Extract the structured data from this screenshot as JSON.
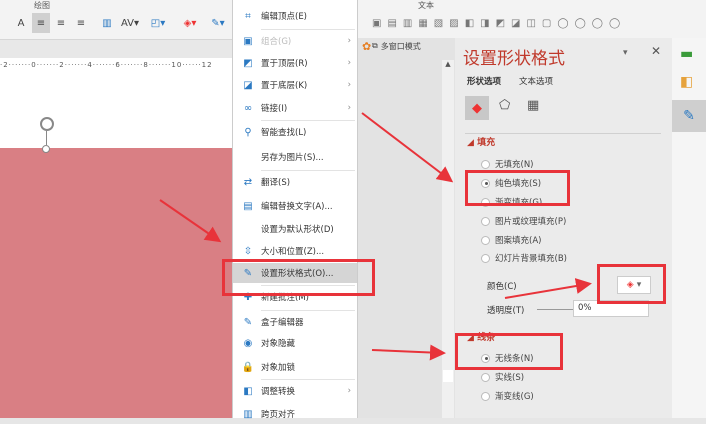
{
  "ribbon": {
    "group_drawing": "绘图",
    "group_text": "文本"
  },
  "ruler": {
    "text": "·2·······0·······2·······4·······6·······8·······10······12"
  },
  "context_menu": {
    "items": [
      {
        "label": "编辑顶点(E)",
        "icon": "edit-points-icon"
      },
      {
        "label": "组合(G)",
        "icon": "group-icon",
        "disabled": true,
        "submenu": true
      },
      {
        "label": "置于顶层(R)",
        "icon": "bring-to-front-icon",
        "submenu": true
      },
      {
        "label": "置于底层(K)",
        "icon": "send-to-back-icon",
        "submenu": true
      },
      {
        "label": "链接(I)",
        "icon": "link-icon",
        "submenu": true
      },
      {
        "label": "智能查找(L)",
        "icon": "search-icon"
      },
      {
        "label": "另存为图片(S)...",
        "icon": ""
      },
      {
        "label": "翻译(S)",
        "icon": "translate-icon"
      },
      {
        "label": "编辑替换文字(A)...",
        "icon": "alt-text-icon"
      },
      {
        "label": "设置为默认形状(D)",
        "icon": ""
      },
      {
        "label": "大小和位置(Z)...",
        "icon": "size-position-icon"
      },
      {
        "label": "设置形状格式(O)...",
        "icon": "format-shape-icon",
        "highlighted": true
      },
      {
        "label": "新建批注(M)",
        "icon": "new-comment-icon"
      },
      {
        "label": "盒子编辑器",
        "icon": "box-editor-icon"
      },
      {
        "label": "对象隐藏",
        "icon": "hide-icon"
      },
      {
        "label": "对象加锁",
        "icon": "lock-icon"
      },
      {
        "label": "调整转换",
        "icon": "convert-icon",
        "submenu": true
      },
      {
        "label": "跨页对齐",
        "icon": "align-icon"
      }
    ]
  },
  "multiwindow_tab": "多窗口模式",
  "pane": {
    "title": "设置形状格式",
    "tabs": [
      "形状选项",
      "文本选项"
    ],
    "fill_section": "填充",
    "fill_options": [
      {
        "label": "无填充(N)",
        "checked": false
      },
      {
        "label": "纯色填充(S)",
        "checked": true
      },
      {
        "label": "渐变填充(G)",
        "checked": false
      },
      {
        "label": "图片或纹理填充(P)",
        "checked": false
      },
      {
        "label": "图案填充(A)",
        "checked": false
      },
      {
        "label": "幻灯片背景填充(B)",
        "checked": false
      }
    ],
    "color_label": "颜色(C)",
    "transparency_label": "透明度(T)",
    "transparency_value": "0%",
    "line_section": "线条",
    "line_options": [
      {
        "label": "无线条(N)",
        "checked": true
      },
      {
        "label": "实线(S)",
        "checked": false
      },
      {
        "label": "渐变线(G)",
        "checked": false
      }
    ]
  },
  "colors": {
    "accent": "#c0392b",
    "annotation": "#e8333a",
    "shape": "#d97f84"
  }
}
